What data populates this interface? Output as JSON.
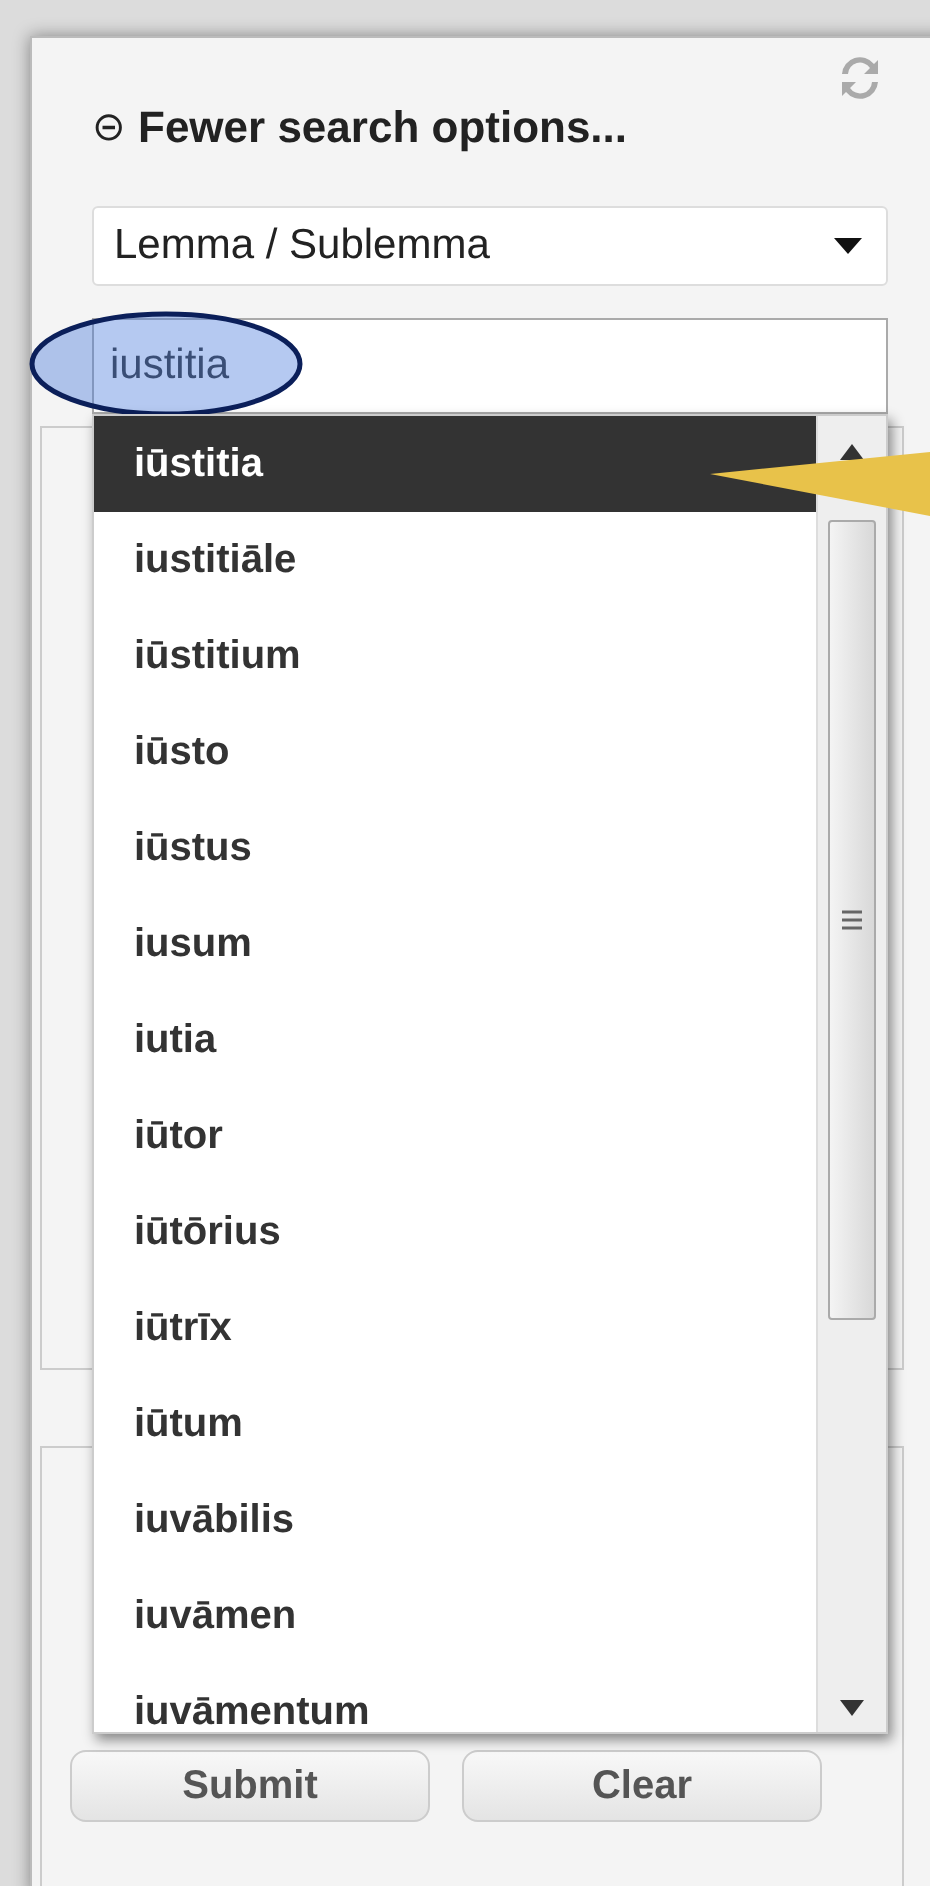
{
  "panel": {
    "toggle_icon": "⊝",
    "title": "Fewer search options...",
    "search_type": {
      "value": "Lemma / Sublemma"
    },
    "search_field": {
      "value": "iustitia"
    }
  },
  "suggestions": [
    {
      "label": "iūstitia",
      "selected": true
    },
    {
      "label": "iustitiāle",
      "selected": false
    },
    {
      "label": "iūstitium",
      "selected": false
    },
    {
      "label": "iūsto",
      "selected": false
    },
    {
      "label": "iūstus",
      "selected": false
    },
    {
      "label": "iusum",
      "selected": false
    },
    {
      "label": "iutia",
      "selected": false
    },
    {
      "label": "iūtor",
      "selected": false
    },
    {
      "label": "iūtōrius",
      "selected": false
    },
    {
      "label": "iūtrīx",
      "selected": false
    },
    {
      "label": "iūtum",
      "selected": false
    },
    {
      "label": "iuvābilis",
      "selected": false
    },
    {
      "label": "iuvāmen",
      "selected": false
    },
    {
      "label": "iuvāmentum",
      "selected": false
    }
  ],
  "buttons": [
    "Submit",
    "Clear"
  ]
}
